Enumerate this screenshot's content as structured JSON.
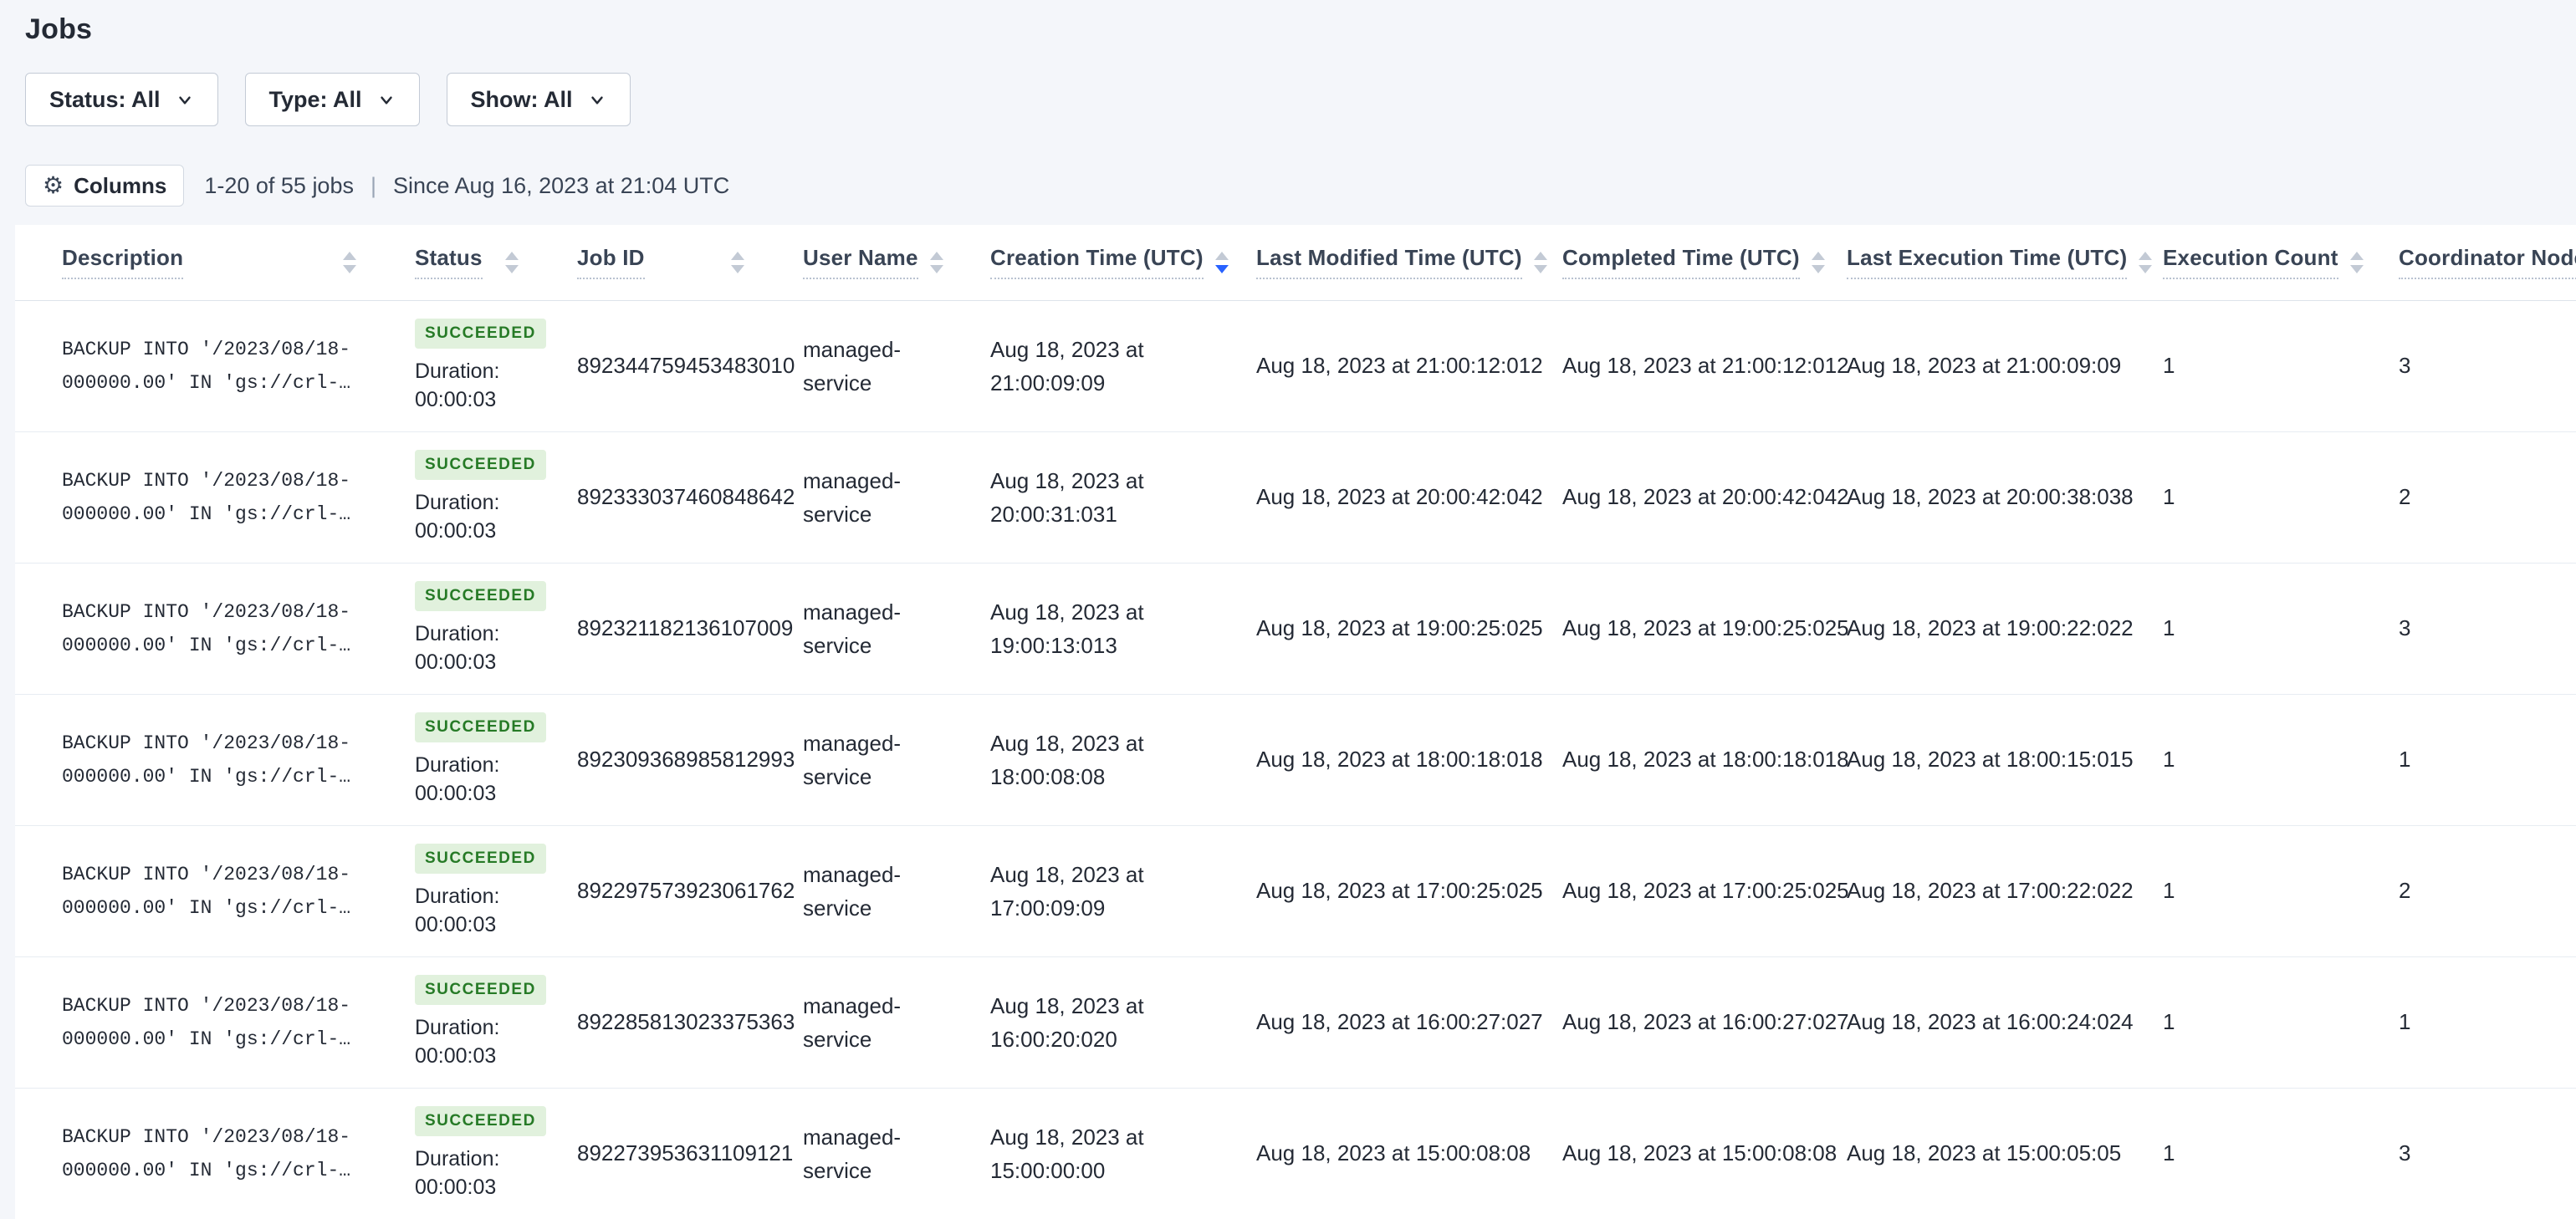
{
  "page": {
    "title": "Jobs"
  },
  "filters": {
    "status": {
      "label": "Status: All"
    },
    "type": {
      "label": "Type: All"
    },
    "show": {
      "label": "Show: All"
    }
  },
  "toolbar": {
    "columns_label": "Columns",
    "columns_icon": "gear-icon",
    "results_count": "1-20 of 55 jobs",
    "separator": "|",
    "since": "Since Aug 16, 2023 at 21:04 UTC"
  },
  "table": {
    "duration_label": "Duration:",
    "columns": [
      {
        "label": "Description",
        "sorted": "none"
      },
      {
        "label": "Status",
        "sorted": "none"
      },
      {
        "label": "Job ID",
        "sorted": "none"
      },
      {
        "label": "User Name",
        "sorted": "none"
      },
      {
        "label": "Creation Time (UTC)",
        "sorted": "desc"
      },
      {
        "label": "Last Modified Time (UTC)",
        "sorted": "none"
      },
      {
        "label": "Completed Time (UTC)",
        "sorted": "none"
      },
      {
        "label": "Last Execution Time (UTC)",
        "sorted": "none"
      },
      {
        "label": "Execution Count",
        "sorted": "none"
      },
      {
        "label": "Coordinator Node",
        "sorted": "none"
      }
    ],
    "rows": [
      {
        "description": "BACKUP INTO '/2023/08/18-000000.00' IN 'gs://crl-…",
        "status": "SUCCEEDED",
        "duration": "00:00:03",
        "job_id": "892344759453483010",
        "user": "managed-service",
        "created": "Aug 18, 2023 at 21:00:09:09",
        "modified": "Aug 18, 2023 at 21:00:12:012",
        "completed": "Aug 18, 2023 at 21:00:12:012",
        "last_exec": "Aug 18, 2023 at 21:00:09:09",
        "exec_count": "1",
        "node": "3"
      },
      {
        "description": "BACKUP INTO '/2023/08/18-000000.00' IN 'gs://crl-…",
        "status": "SUCCEEDED",
        "duration": "00:00:03",
        "job_id": "892333037460848642",
        "user": "managed-service",
        "created": "Aug 18, 2023 at 20:00:31:031",
        "modified": "Aug 18, 2023 at 20:00:42:042",
        "completed": "Aug 18, 2023 at 20:00:42:042",
        "last_exec": "Aug 18, 2023 at 20:00:38:038",
        "exec_count": "1",
        "node": "2"
      },
      {
        "description": "BACKUP INTO '/2023/08/18-000000.00' IN 'gs://crl-…",
        "status": "SUCCEEDED",
        "duration": "00:00:03",
        "job_id": "892321182136107009",
        "user": "managed-service",
        "created": "Aug 18, 2023 at 19:00:13:013",
        "modified": "Aug 18, 2023 at 19:00:25:025",
        "completed": "Aug 18, 2023 at 19:00:25:025",
        "last_exec": "Aug 18, 2023 at 19:00:22:022",
        "exec_count": "1",
        "node": "3"
      },
      {
        "description": "BACKUP INTO '/2023/08/18-000000.00' IN 'gs://crl-…",
        "status": "SUCCEEDED",
        "duration": "00:00:03",
        "job_id": "892309368985812993",
        "user": "managed-service",
        "created": "Aug 18, 2023 at 18:00:08:08",
        "modified": "Aug 18, 2023 at 18:00:18:018",
        "completed": "Aug 18, 2023 at 18:00:18:018",
        "last_exec": "Aug 18, 2023 at 18:00:15:015",
        "exec_count": "1",
        "node": "1"
      },
      {
        "description": "BACKUP INTO '/2023/08/18-000000.00' IN 'gs://crl-…",
        "status": "SUCCEEDED",
        "duration": "00:00:03",
        "job_id": "892297573923061762",
        "user": "managed-service",
        "created": "Aug 18, 2023 at 17:00:09:09",
        "modified": "Aug 18, 2023 at 17:00:25:025",
        "completed": "Aug 18, 2023 at 17:00:25:025",
        "last_exec": "Aug 18, 2023 at 17:00:22:022",
        "exec_count": "1",
        "node": "2"
      },
      {
        "description": "BACKUP INTO '/2023/08/18-000000.00' IN 'gs://crl-…",
        "status": "SUCCEEDED",
        "duration": "00:00:03",
        "job_id": "892285813023375363",
        "user": "managed-service",
        "created": "Aug 18, 2023 at 16:00:20:020",
        "modified": "Aug 18, 2023 at 16:00:27:027",
        "completed": "Aug 18, 2023 at 16:00:27:027",
        "last_exec": "Aug 18, 2023 at 16:00:24:024",
        "exec_count": "1",
        "node": "1"
      },
      {
        "description": "BACKUP INTO '/2023/08/18-000000.00' IN 'gs://crl-…",
        "status": "SUCCEEDED",
        "duration": "00:00:03",
        "job_id": "892273953631109121",
        "user": "managed-service",
        "created": "Aug 18, 2023 at 15:00:00:00",
        "modified": "Aug 18, 2023 at 15:00:08:08",
        "completed": "Aug 18, 2023 at 15:00:08:08",
        "last_exec": "Aug 18, 2023 at 15:00:05:05",
        "exec_count": "1",
        "node": "3"
      }
    ]
  },
  "colors": {
    "page_bg": "#f4f6fa",
    "panel_bg": "#ffffff",
    "body_text": "#242a35",
    "header_text": "#394455",
    "row_border": "#e7ecf2",
    "succeeded_bg": "#e1f1dd",
    "succeeded_text": "#267a26",
    "sort_active": "#2962ff",
    "sort_inactive": "#c3cad5"
  }
}
